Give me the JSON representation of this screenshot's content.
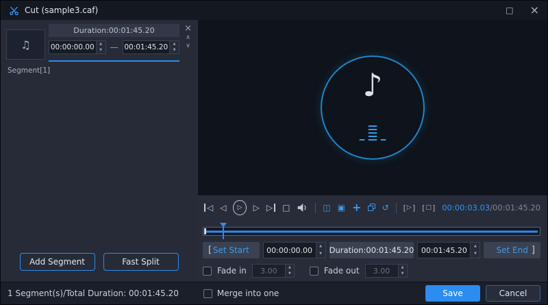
{
  "titlebar": {
    "title": "Cut (sample3.caf)",
    "maximize_glyph": "□",
    "close_glyph": "×"
  },
  "brackets": {
    "open": "[",
    "close": "]"
  },
  "spin": {
    "up": "▲",
    "down": "▼"
  },
  "left": {
    "segment": {
      "thumb_icon": "♫",
      "duration": "Duration:00:01:45.20",
      "start": "00:00:00.00",
      "dash": "—",
      "end": "00:01:45.20",
      "name": "Segment[1]",
      "close_glyph": "×",
      "up_glyph": "∧",
      "down_glyph": "∨"
    },
    "add_segment": "Add Segment",
    "fast_split": "Fast Split"
  },
  "preview": {
    "note_icon": "♪"
  },
  "toolbar": {
    "skip_back": "◁",
    "step_back": "◁",
    "play": "▷",
    "step_fwd": "▷",
    "skip_fwd": "▷",
    "stop": "□",
    "split": "◫",
    "region": "▣",
    "add": "+",
    "reset": "↺",
    "preview_play": "▷",
    "preview_stop": "□",
    "time_current": "00:00:03.03",
    "time_total": "/00:01:45.20"
  },
  "trim": {
    "set_start": "Set Start",
    "start": "00:00:00.00",
    "duration": "Duration:00:01:45.20",
    "end": "00:01:45.20",
    "set_end": "Set End"
  },
  "fade": {
    "in_label": "Fade in",
    "in_value": "3.00",
    "out_label": "Fade out",
    "out_value": "3.00"
  },
  "footer": {
    "summary": "1 Segment(s)/Total Duration: 00:01:45.20",
    "merge": "Merge into one",
    "save": "Save",
    "cancel": "Cancel"
  },
  "colors": {
    "accent": "#2d8cf0"
  }
}
